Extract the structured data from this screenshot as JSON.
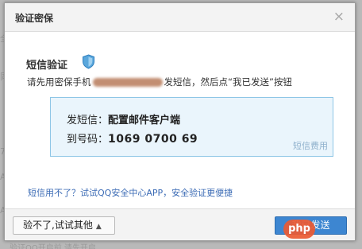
{
  "backdrop": {
    "left_bits": [
      "全",
      "同",
      "7",
      "A",
      "A"
    ],
    "bottom_text": "验证QQ开启前,请先开启..."
  },
  "dialog": {
    "title": "验证密保",
    "close_label": "×",
    "heading": "短信验证",
    "instruction_before": "请先用密保手机",
    "instruction_after": "发短信，然后点“我已发送”按钮",
    "sms": {
      "send_label": "发短信：",
      "send_value": "配置邮件客户端",
      "to_label": "到号码：",
      "to_value": "1069 0700 69",
      "fee_link": "短信费用"
    },
    "alt_link": "短信用不了？试试QQ安全中心APP，安全验证更便捷",
    "footer": {
      "other_button": "验不了,试试其他",
      "other_arrow": "▲",
      "sent_button": "我已发送",
      "watermark": "php"
    }
  },
  "colors": {
    "accent": "#3d86d1",
    "info_bg": "#eaf5fc",
    "info_border": "#8ec6e6",
    "link": "#3b6bb5"
  }
}
